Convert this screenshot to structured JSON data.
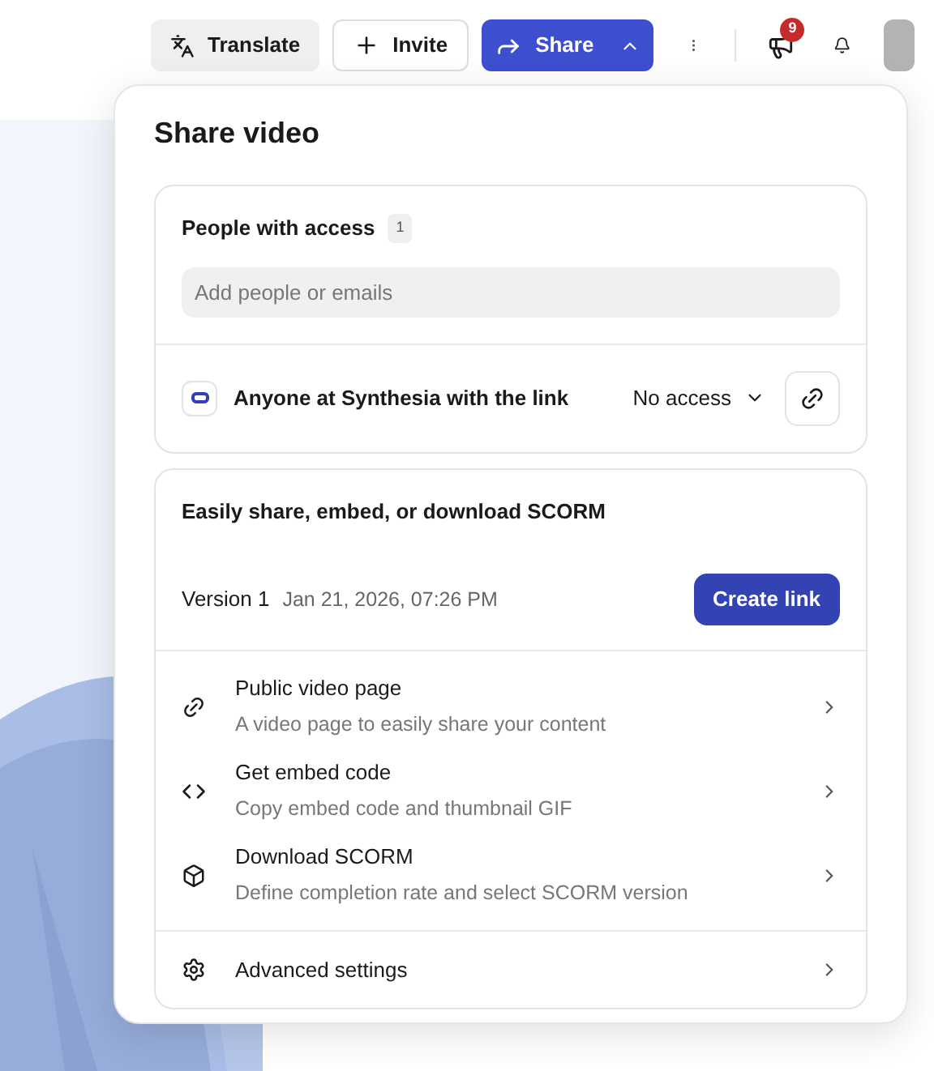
{
  "toolbar": {
    "translate": "Translate",
    "invite": "Invite",
    "share": "Share",
    "notification_count": "9"
  },
  "popover": {
    "title": "Share video",
    "access": {
      "heading": "People with access",
      "count": "1",
      "search": {
        "placeholder": "Add people or emails"
      },
      "link_label": "Anyone at Synthesia with the link",
      "access_level": "No access"
    },
    "publish": {
      "heading": "Easily share, embed, or download SCORM",
      "version": "Version 1",
      "date": "Jan 21, 2026, 07:26 PM",
      "create_button": "Create link",
      "options": [
        {
          "title": "Public video page",
          "description": "A video page to easily share your content"
        },
        {
          "title": "Get embed code",
          "description": "Copy embed code and thumbnail GIF"
        },
        {
          "title": "Download SCORM",
          "description": "Define completion rate and select SCORM version"
        }
      ],
      "advanced": "Advanced settings"
    }
  }
}
